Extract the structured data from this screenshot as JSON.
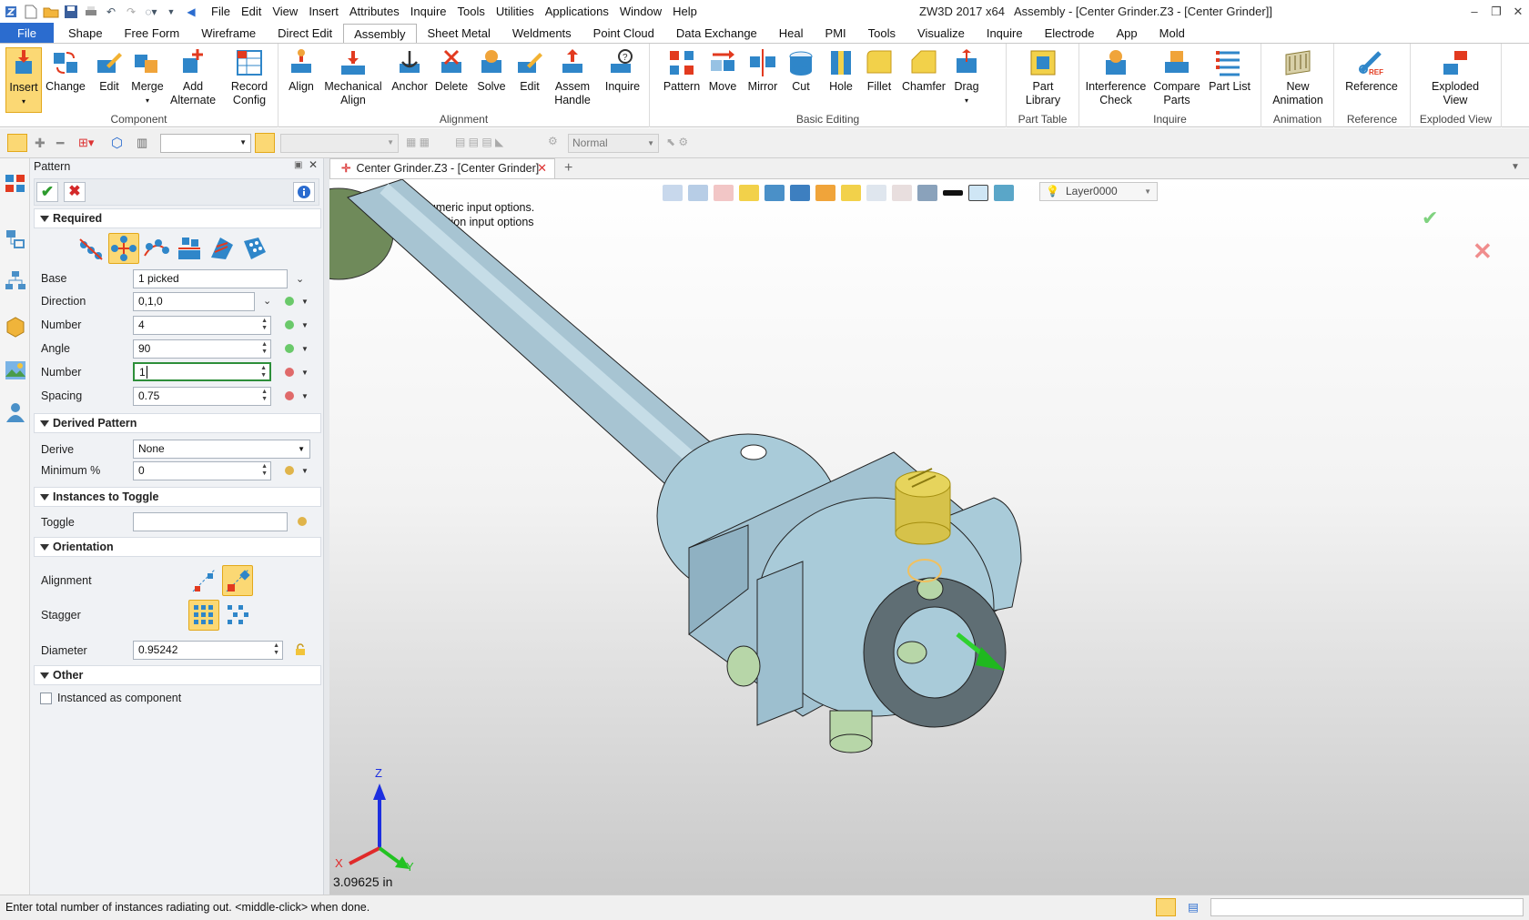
{
  "app": {
    "title": "ZW3D 2017  x64",
    "doc_title": "Assembly - [Center Grinder.Z3 - [Center Grinder]]"
  },
  "menus": [
    "File",
    "Edit",
    "View",
    "Insert",
    "Attributes",
    "Inquire",
    "Tools",
    "Utilities",
    "Applications",
    "Window",
    "Help"
  ],
  "tabs": [
    "File",
    "Shape",
    "Free Form",
    "Wireframe",
    "Direct Edit",
    "Assembly",
    "Sheet Metal",
    "Weldments",
    "Point Cloud",
    "Data Exchange",
    "Heal",
    "PMI",
    "Tools",
    "Visualize",
    "Inquire",
    "Electrode",
    "App",
    "Mold"
  ],
  "active_tab": "Assembly",
  "ribbon": {
    "component": {
      "title": "Component",
      "buttons": [
        "Insert",
        "Change",
        "Edit",
        "Merge",
        "Add Alternate",
        "Record Config"
      ]
    },
    "alignment": {
      "title": "Alignment",
      "buttons": [
        "Align",
        "Mechanical Align",
        "Anchor",
        "Delete",
        "Solve",
        "Edit",
        "Assem Handle",
        "Inquire"
      ]
    },
    "basic_editing": {
      "title": "Basic Editing",
      "buttons": [
        "Pattern",
        "Move",
        "Mirror",
        "Cut",
        "Hole",
        "Fillet",
        "Chamfer",
        "Drag"
      ]
    },
    "part_table": {
      "title": "Part Table",
      "buttons": [
        "Part Library"
      ]
    },
    "inquire": {
      "title": "Inquire",
      "buttons": [
        "Interference Check",
        "Compare Parts",
        "Part List"
      ]
    },
    "animation": {
      "title": "Animation",
      "buttons": [
        "New Animation"
      ]
    },
    "reference": {
      "title": "Reference",
      "buttons": [
        "Reference"
      ]
    },
    "exploded_view": {
      "title": "Exploded View",
      "buttons": [
        "Exploded View"
      ]
    }
  },
  "toolbar2": {
    "render_mode": "Normal"
  },
  "panel": {
    "title": "Pattern",
    "sections": {
      "required": "Required",
      "derived": "Derived Pattern",
      "toggle": "Instances to Toggle",
      "orientation": "Orientation",
      "other": "Other"
    },
    "fields": {
      "base": {
        "label": "Base",
        "value": "1 picked"
      },
      "direction": {
        "label": "Direction",
        "value": "0,1,0"
      },
      "number1": {
        "label": "Number",
        "value": "4"
      },
      "angle": {
        "label": "Angle",
        "value": "90"
      },
      "number2": {
        "label": "Number",
        "value": "1"
      },
      "spacing": {
        "label": "Spacing",
        "value": "0.75"
      },
      "derive": {
        "label": "Derive",
        "value": "None"
      },
      "minimum": {
        "label": "Minimum %",
        "value": "0"
      },
      "toggle": {
        "label": "Toggle",
        "value": ""
      },
      "alignment": {
        "label": "Alignment"
      },
      "stagger": {
        "label": "Stagger"
      },
      "diameter": {
        "label": "Diameter",
        "value": "0.95242"
      },
      "instanced": {
        "label": "Instanced as component",
        "checked": false
      }
    }
  },
  "document_tab": "Center Grinder.Z3 - [Center Grinder]",
  "viewport": {
    "hints": [
      "<right-click> for numeric input options.",
      "<right-click> for direction input options"
    ],
    "layer": "Layer0000",
    "measure": "3.09625 in",
    "axes": {
      "x": "X",
      "y": "Y",
      "z": "Z"
    }
  },
  "status_text": "Enter total number of instances radiating out.  <middle-click> when done.",
  "colors": {
    "accent": "#2b6ccf",
    "part": "#a9cbd9",
    "selected": "#d6c24a",
    "arrow": "#2fd12f"
  }
}
